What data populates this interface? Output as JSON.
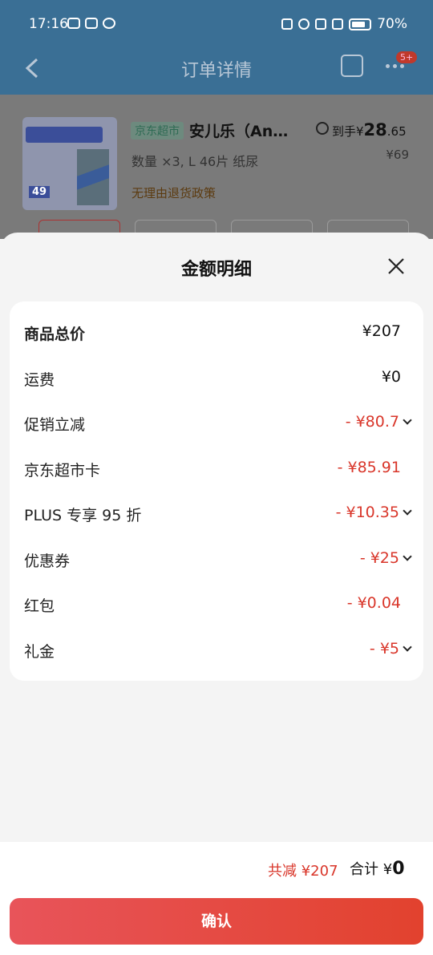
{
  "status": {
    "time": "17:16",
    "battery": "70%"
  },
  "header": {
    "title": "订单详情",
    "badge": "5+"
  },
  "product": {
    "store_tag": "京东超市",
    "name": "安儿乐（An…",
    "to_hand_label": "到手¥",
    "to_hand_price_main": "28",
    "to_hand_price_decimal": ".65",
    "original_price": "¥69",
    "spec": "数量 ×3, L 46片 纸尿",
    "policy": "无理由退货政策",
    "image_text_number": "49"
  },
  "sheet": {
    "title": "金额明细",
    "rows": [
      {
        "label": "商品总价",
        "value": "¥207",
        "red": false,
        "chevron": false
      },
      {
        "label": "运费",
        "value": "¥0",
        "red": false,
        "chevron": false
      },
      {
        "label": "促销立减",
        "value": "- ¥80.7",
        "red": true,
        "chevron": true
      },
      {
        "label": "京东超市卡",
        "value": "- ¥85.91",
        "red": true,
        "chevron": false
      },
      {
        "label": "PLUS 专享 95 折",
        "value": "- ¥10.35",
        "red": true,
        "chevron": true
      },
      {
        "label": "优惠券",
        "value": "- ¥25",
        "red": true,
        "chevron": true
      },
      {
        "label": "红包",
        "value": "- ¥0.04",
        "red": true,
        "chevron": false
      },
      {
        "label": "礼金",
        "value": "- ¥5",
        "red": true,
        "chevron": true
      }
    ]
  },
  "footer": {
    "saved": "共减 ¥207",
    "total_label": "合计 ¥",
    "total_value": "0",
    "confirm": "确认"
  },
  "colors": {
    "accent_red": "#d9362a",
    "header_blue": "#3a6f95"
  }
}
